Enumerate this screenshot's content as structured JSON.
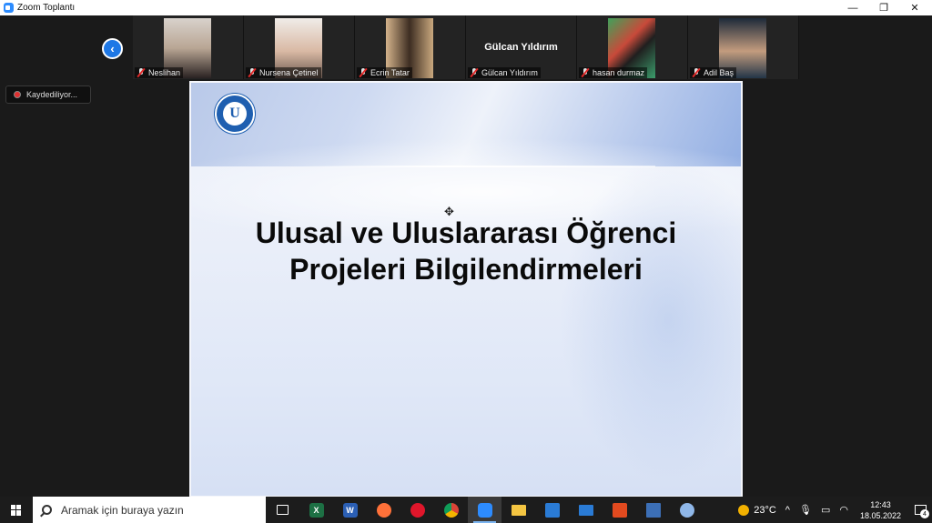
{
  "window": {
    "title": "Zoom Toplantı",
    "minimize": "—",
    "restore": "❐",
    "close": "✕"
  },
  "meeting": {
    "prev_arrow": "‹",
    "recording_label": "Kaydediliyor...",
    "participants": [
      {
        "name": "Neslihan",
        "video": true,
        "muted": true
      },
      {
        "name": "Nursena Çetinel",
        "video": true,
        "muted": true
      },
      {
        "name": "Ecrin Tatar",
        "video": true,
        "muted": true
      },
      {
        "name": "Gülcan Yıldırım",
        "video": false,
        "display_name": "Gülcan Yıldırım",
        "muted": true
      },
      {
        "name": "hasan durmaz",
        "video": true,
        "muted": true
      },
      {
        "name": "Adil Baş",
        "video": true,
        "muted": true
      }
    ]
  },
  "slide": {
    "title_line1": "Ulusal ve Uluslararası Öğrenci",
    "title_line2": "Projeleri Bilgilendirmeleri",
    "logo_letter": "U"
  },
  "taskbar": {
    "search_placeholder": "Aramak için buraya yazın",
    "apps": [
      "task-view",
      "excel",
      "word",
      "firefox",
      "opera",
      "chrome",
      "zoom",
      "file-explorer",
      "microsoft-store",
      "mail",
      "office",
      "calculator",
      "paint"
    ],
    "weather": "23°C",
    "time": "12:43",
    "date": "18.05.2022",
    "notifications": "4"
  },
  "colors": {
    "accent": "#1e78e6",
    "stage_bg": "#1a1a1a",
    "recording_dot": "#e03030"
  }
}
